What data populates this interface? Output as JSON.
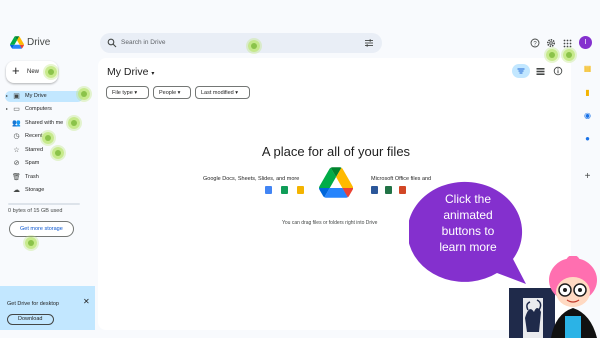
{
  "app": {
    "brand": "Drive",
    "avatar_initial": "I"
  },
  "search": {
    "placeholder": "Search in Drive"
  },
  "sidebar": {
    "new_label": "New",
    "items": [
      {
        "label": "My Drive",
        "icon": "drive-icon",
        "active": true
      },
      {
        "label": "Computers",
        "icon": "computer-icon"
      },
      {
        "label": "Shared with me",
        "icon": "people-icon"
      },
      {
        "label": "Recent",
        "icon": "clock-icon"
      },
      {
        "label": "Starred",
        "icon": "star-icon"
      },
      {
        "label": "Spam",
        "icon": "spam-icon"
      },
      {
        "label": "Trash",
        "icon": "trash-icon"
      },
      {
        "label": "Storage",
        "icon": "cloud-icon"
      }
    ],
    "storage_text": "0 bytes of 15 GB used",
    "get_storage_label": "Get more storage"
  },
  "promo": {
    "title": "Get Drive for desktop",
    "close": "✕",
    "download_label": "Download"
  },
  "main": {
    "title": "My Drive",
    "filters": [
      "File type",
      "People",
      "Last modified"
    ],
    "empty_title": "A place for all of your files",
    "gdocs_label": "Google Docs, Sheets, Slides, and more",
    "ms_label": "Microsoft Office files and",
    "drag_hint": "You can drag files or folders right into Drive"
  },
  "callout": {
    "lines": [
      "Click the",
      "animated",
      "buttons to",
      "learn more"
    ]
  },
  "colors": {
    "accent": "#0b57d0",
    "selected": "#c2e7ff",
    "bubble": "#8430ce",
    "mascot_hair": "#ff6fb0",
    "hotspot": "#8bc34a"
  }
}
